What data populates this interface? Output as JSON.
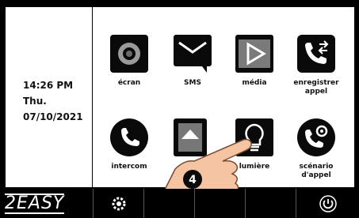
{
  "status": {
    "time": "14:26 PM",
    "day": "Thu.",
    "date": "07/10/2021"
  },
  "tiles": [
    {
      "label": "écran",
      "icon": "camera-icon"
    },
    {
      "label": "SMS",
      "icon": "mail-icon"
    },
    {
      "label": "média",
      "icon": "play-icon"
    },
    {
      "label": "enregistrer\nappel",
      "icon": "call-record-icon"
    },
    {
      "label": "intercom",
      "icon": "phone-icon"
    },
    {
      "label": "",
      "icon": "image-icon"
    },
    {
      "label": "lumière",
      "icon": "bulb-icon"
    },
    {
      "label": "scénario\nd'appel",
      "icon": "call-settings-icon"
    }
  ],
  "taskbar": {
    "logo": "2EASY"
  },
  "annotation": {
    "step": "4"
  }
}
